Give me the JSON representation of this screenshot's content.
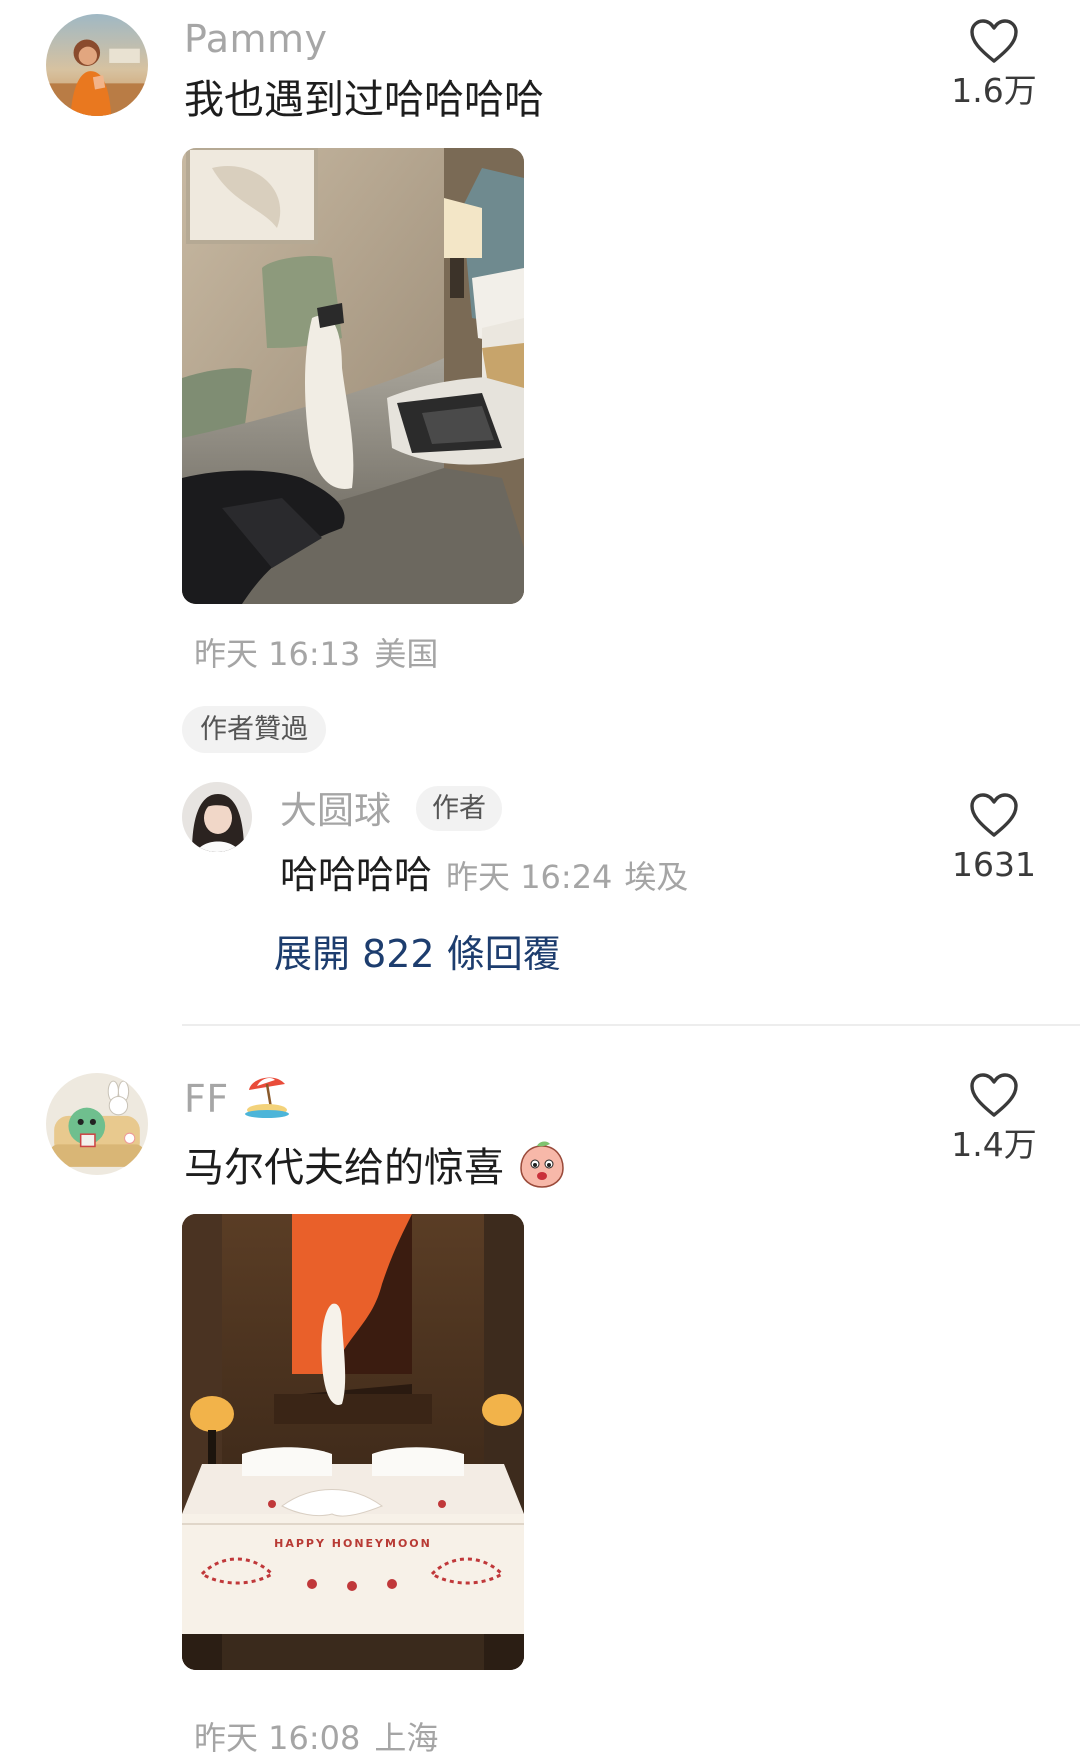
{
  "comments": [
    {
      "username": "Pammy",
      "text": "我也遇到过哈哈哈哈",
      "likes": "1.6万",
      "time": "昨天 16:13",
      "location": "美国",
      "author_liked_label": "作者贊過",
      "reply": {
        "username": "大圆球",
        "badge": "作者",
        "text": "哈哈哈哈",
        "time": "昨天 16:24",
        "location": "埃及",
        "likes": "1631"
      },
      "expand_replies": "展開 822 條回覆"
    },
    {
      "username": "FF",
      "username_emoji": "beach-umbrella-emoji",
      "text": "马尔代夫给的惊喜",
      "text_emoji": "peach-face-emoji",
      "likes": "1.4万",
      "time": "昨天 16:08",
      "location": "上海"
    }
  ],
  "colors": {
    "link": "#1d3d6e",
    "muted": "#a5a5a5",
    "chip_bg": "#f2f2f2"
  },
  "icons": {
    "like": "heart-outline-icon"
  }
}
